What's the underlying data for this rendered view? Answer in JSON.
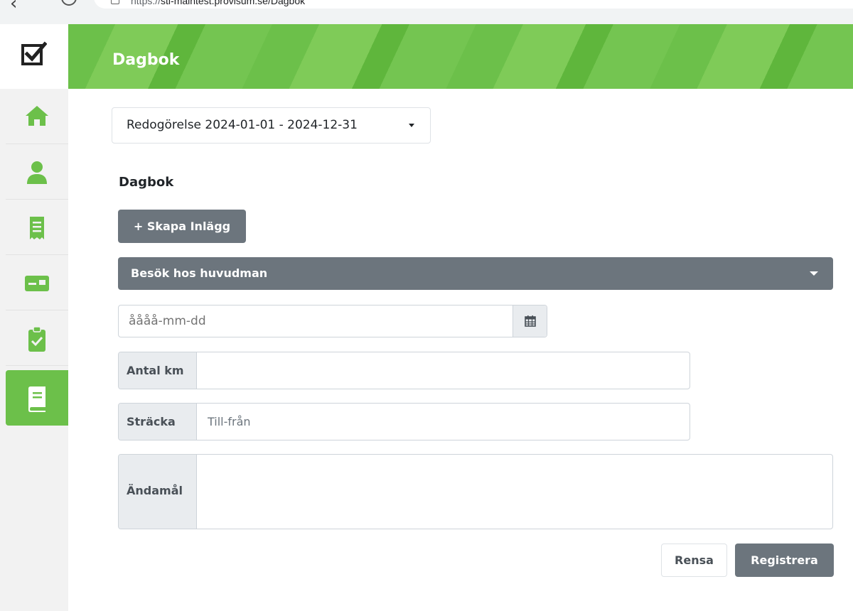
{
  "browser": {
    "url_prefix": "https://",
    "url_rest": "sti-maintest.provisum.se/Dagbok"
  },
  "header": {
    "title": "Dagbok"
  },
  "sidebar": {
    "items": [
      {
        "icon": "home-icon"
      },
      {
        "icon": "user-icon"
      },
      {
        "icon": "receipt-icon"
      },
      {
        "icon": "id-card-icon"
      },
      {
        "icon": "clipboard-check-icon"
      },
      {
        "icon": "book-icon",
        "active": true
      }
    ]
  },
  "period": {
    "selected": "Redogörelse 2024-01-01 - 2024-12-31"
  },
  "main": {
    "section_title": "Dagbok",
    "create_button": "+ Skapa Inlägg",
    "type_selected": "Besök hos huvudman",
    "date_placeholder": "åååå-mm-dd",
    "km_label": "Antal km",
    "km_value": "",
    "route_label": "Sträcka",
    "route_placeholder": "Till-från",
    "purpose_label": "Ändamål",
    "purpose_value": "",
    "clear_button": "Rensa",
    "submit_button": "Registrera"
  },
  "colors": {
    "brand_green": "#6cc04a",
    "button_gray": "#6c757d"
  }
}
